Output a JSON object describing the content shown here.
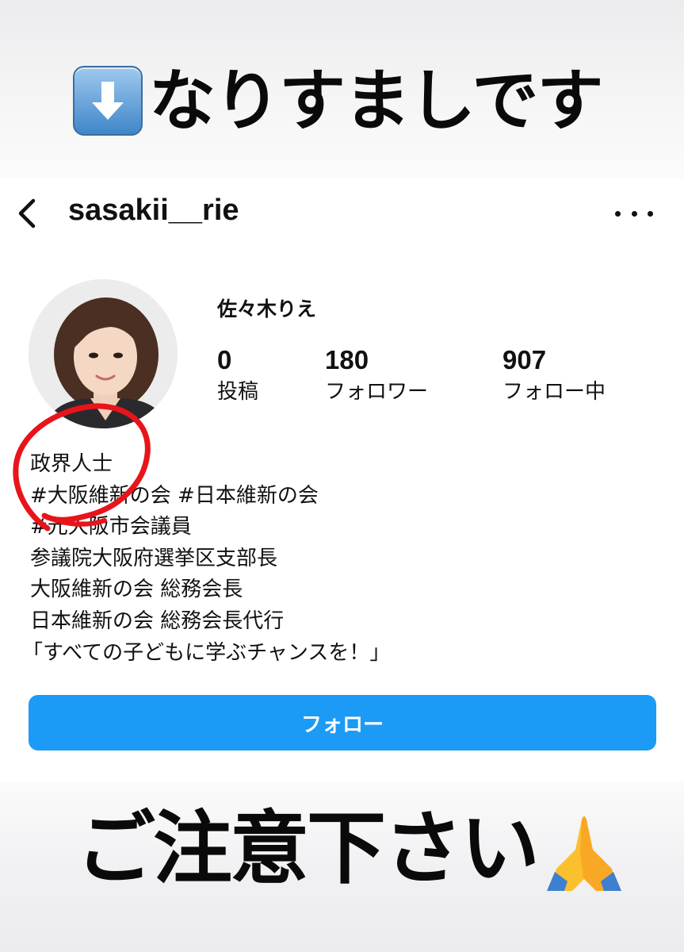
{
  "warning_banner": {
    "text": "なりすましです",
    "icon": "down-arrow-emoji"
  },
  "nav": {
    "username": "sasakii__rie",
    "back_icon": "chevron-left-icon",
    "more_icon": "ellipsis-icon"
  },
  "profile": {
    "display_name": "佐々木りえ",
    "stats": [
      {
        "value": "0",
        "label": "投稿"
      },
      {
        "value": "180",
        "label": "フォロワー"
      },
      {
        "value": "907",
        "label": "フォロー中"
      }
    ],
    "bio": [
      "政界人士",
      "#大阪維新の会 #日本維新の会",
      "#元大阪市会議員",
      "参議院大阪府選挙区支部長",
      "大阪維新の会 総務会長",
      "日本維新の会 総務会長代行",
      "「すべての子どもに学ぶチャンスを！」"
    ]
  },
  "follow_button": {
    "label": "フォロー",
    "color": "#1b9bf5"
  },
  "caution_banner": {
    "text": "ご注意下さい",
    "icon": "folded-hands-emoji"
  },
  "annotation": {
    "color": "#e8141b"
  }
}
